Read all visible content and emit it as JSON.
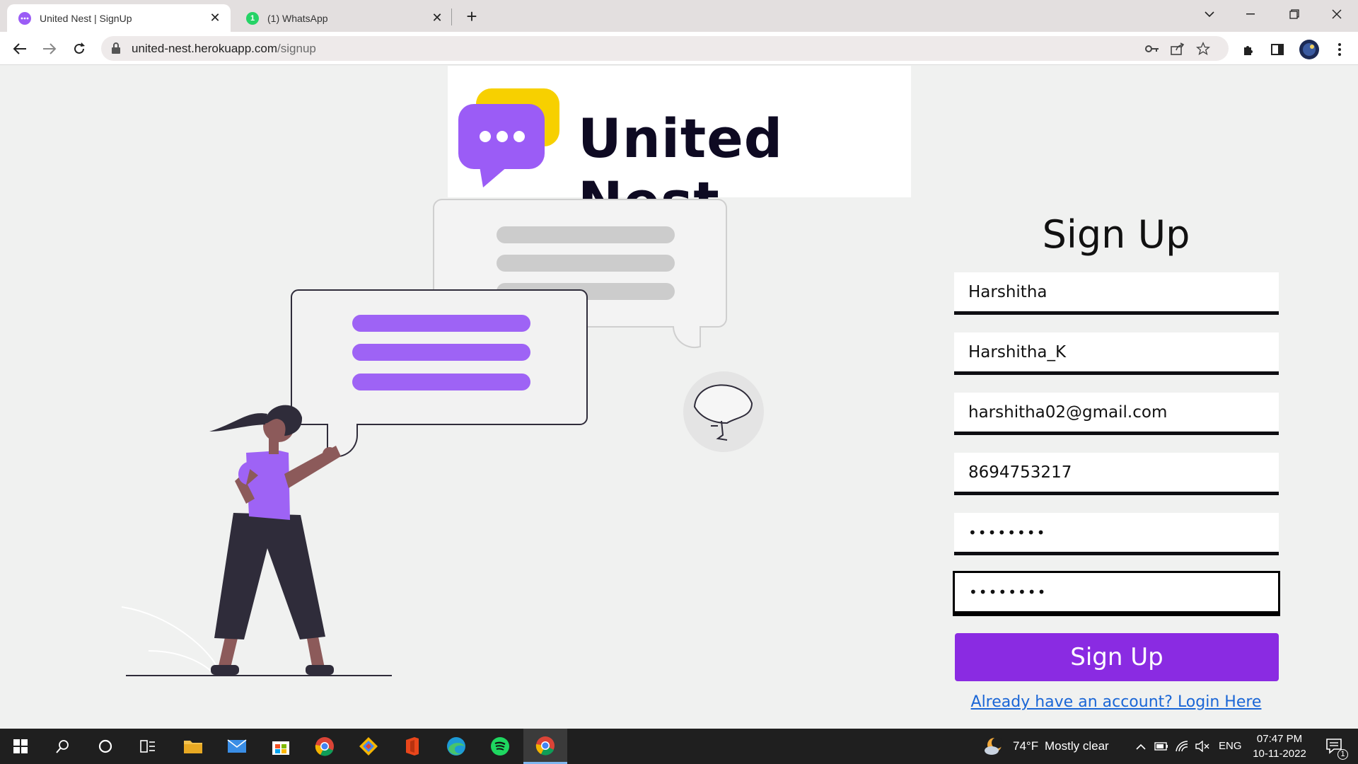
{
  "browser": {
    "tabs": [
      {
        "label": "United Nest | SignUp",
        "active": true
      },
      {
        "label": "(1) WhatsApp",
        "active": false,
        "badge": "1"
      }
    ],
    "url_host": "united-nest.herokuapp.com",
    "url_path": "/signup"
  },
  "logo": {
    "text": "United Nest"
  },
  "form": {
    "title": "Sign Up",
    "fields": [
      {
        "value": "Harshitha"
      },
      {
        "value": "Harshitha_K"
      },
      {
        "value": "harshitha02@gmail.com"
      },
      {
        "value": "8694753217"
      },
      {
        "value": "••••••••"
      },
      {
        "value": "••••••••"
      }
    ],
    "submit_label": "Sign Up",
    "login_link": "Already have an account? Login Here"
  },
  "taskbar": {
    "weather_temp": "74°F",
    "weather_text": "Mostly clear",
    "language": "ENG",
    "time": "07:47 PM",
    "date": "10-11-2022",
    "notification_count": "1"
  },
  "colors": {
    "accent_purple": "#8a2be2",
    "illustration_purple": "#9e63f5",
    "logo_yellow": "#f7d000",
    "logo_purple": "#9b5cf6",
    "link_blue": "#1a66d6"
  }
}
